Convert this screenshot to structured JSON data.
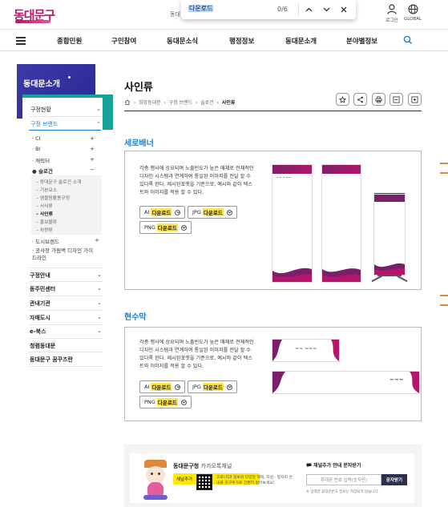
{
  "header": {
    "logo_text": "동대문구",
    "hidden_text": "동대",
    "login_label": "로그인",
    "global_label": "GLOBAL"
  },
  "findbar": {
    "query": "다운로드",
    "count": "0/6"
  },
  "nav": {
    "items": [
      "종합민원",
      "구민참여",
      "동대문소식",
      "행정정보",
      "동대문소개",
      "분야별정보"
    ]
  },
  "sidebar": {
    "title": "동대문소개",
    "groups": [
      {
        "label": "구정현황"
      },
      {
        "label": "구정 브랜드"
      }
    ],
    "brand_sub": [
      "CI",
      "BI",
      "캐릭터",
      "슬로건"
    ],
    "slogan_sub": [
      "동대문구 슬로건 소개",
      "기본요소",
      "엠블럼활용규정",
      "서식류",
      "사인류",
      "홍보물류",
      "차량류"
    ],
    "extra": [
      "도시브랜드",
      "공사장 가림벽 디자인 가이드라인"
    ],
    "menu": [
      "구정안내",
      "동주민센터",
      "관내기관",
      "자매도시",
      "e-북스",
      "청렴동대문",
      "동대문구 꿈꾸즈란"
    ]
  },
  "page": {
    "title": "사인류",
    "breadcrumb": [
      "희망동대문",
      "구정 브랜드",
      "슬로건",
      "사인류"
    ]
  },
  "sections": [
    {
      "title": "세로배너",
      "desc": "각종 행사에 상요되며 노출빈도가 높은 매체로 전체적인 디자인 시스템과 연계하여 통일된 이미지를 전달 할 수 있다록 한다. 제시된포맷을 기준으로, 예시와 같이 텍스트와 이미지를 적용 할 수 있다.",
      "buttons": [
        {
          "prefix": "AI",
          "label": "다운로드"
        },
        {
          "prefix": "JPG",
          "label": "다운로드"
        },
        {
          "prefix": "PNG",
          "label": "다운로드"
        }
      ]
    },
    {
      "title": "현수막",
      "desc": "각종 행사에 상요되며 노출빈도가 높은 매체로 전체적인 디자인 시스템과 연계하여 통일된 이미지를 전달 할 수 있다록 한다. 제시된포맷을 기준으로, 예시와 같이 텍스트와 이미지를 적용 할 수 있다.",
      "buttons": [
        {
          "prefix": "AI",
          "label": "다운로드"
        },
        {
          "prefix": "JPG",
          "label": "다운로드"
        },
        {
          "prefix": "PNG",
          "label": "다운로드"
        }
      ]
    }
  ],
  "footer": {
    "channel": "동대문구청",
    "channel_suffix": "카카오톡채널",
    "channel_desc": "코로나19 정보와 다양한 혜택, 지원 · 일자리 안내를 친구추가로 간편히 받아보세요!",
    "add_friend": "채널추가",
    "sms_title": "채널추가 안내 문자받기",
    "phone_placeholder": "휴대폰 번호 입력(숫자만)",
    "sms_button": "문자받기",
    "sms_note": "※ 입력한 휴대폰번호 정보는 저장되지 않습니다."
  },
  "colors": {
    "brand": "#b5166b",
    "accent_blue": "#1d7fd6",
    "sidebar_navy": "#2a2893",
    "sidebar_teal": "#16a39a",
    "highlight": "#ffe44d"
  }
}
